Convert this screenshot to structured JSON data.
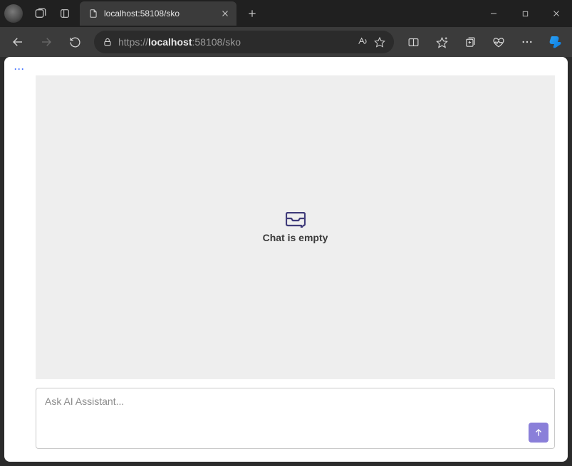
{
  "browser": {
    "tab_title": "localhost:58108/sko",
    "url_prefix": "https://",
    "url_host": "localhost",
    "url_suffix": ":58108/sko"
  },
  "page": {
    "more_menu": "···",
    "empty_state": "Chat is empty",
    "composer_placeholder": "Ask AI Assistant...",
    "composer_value": ""
  }
}
